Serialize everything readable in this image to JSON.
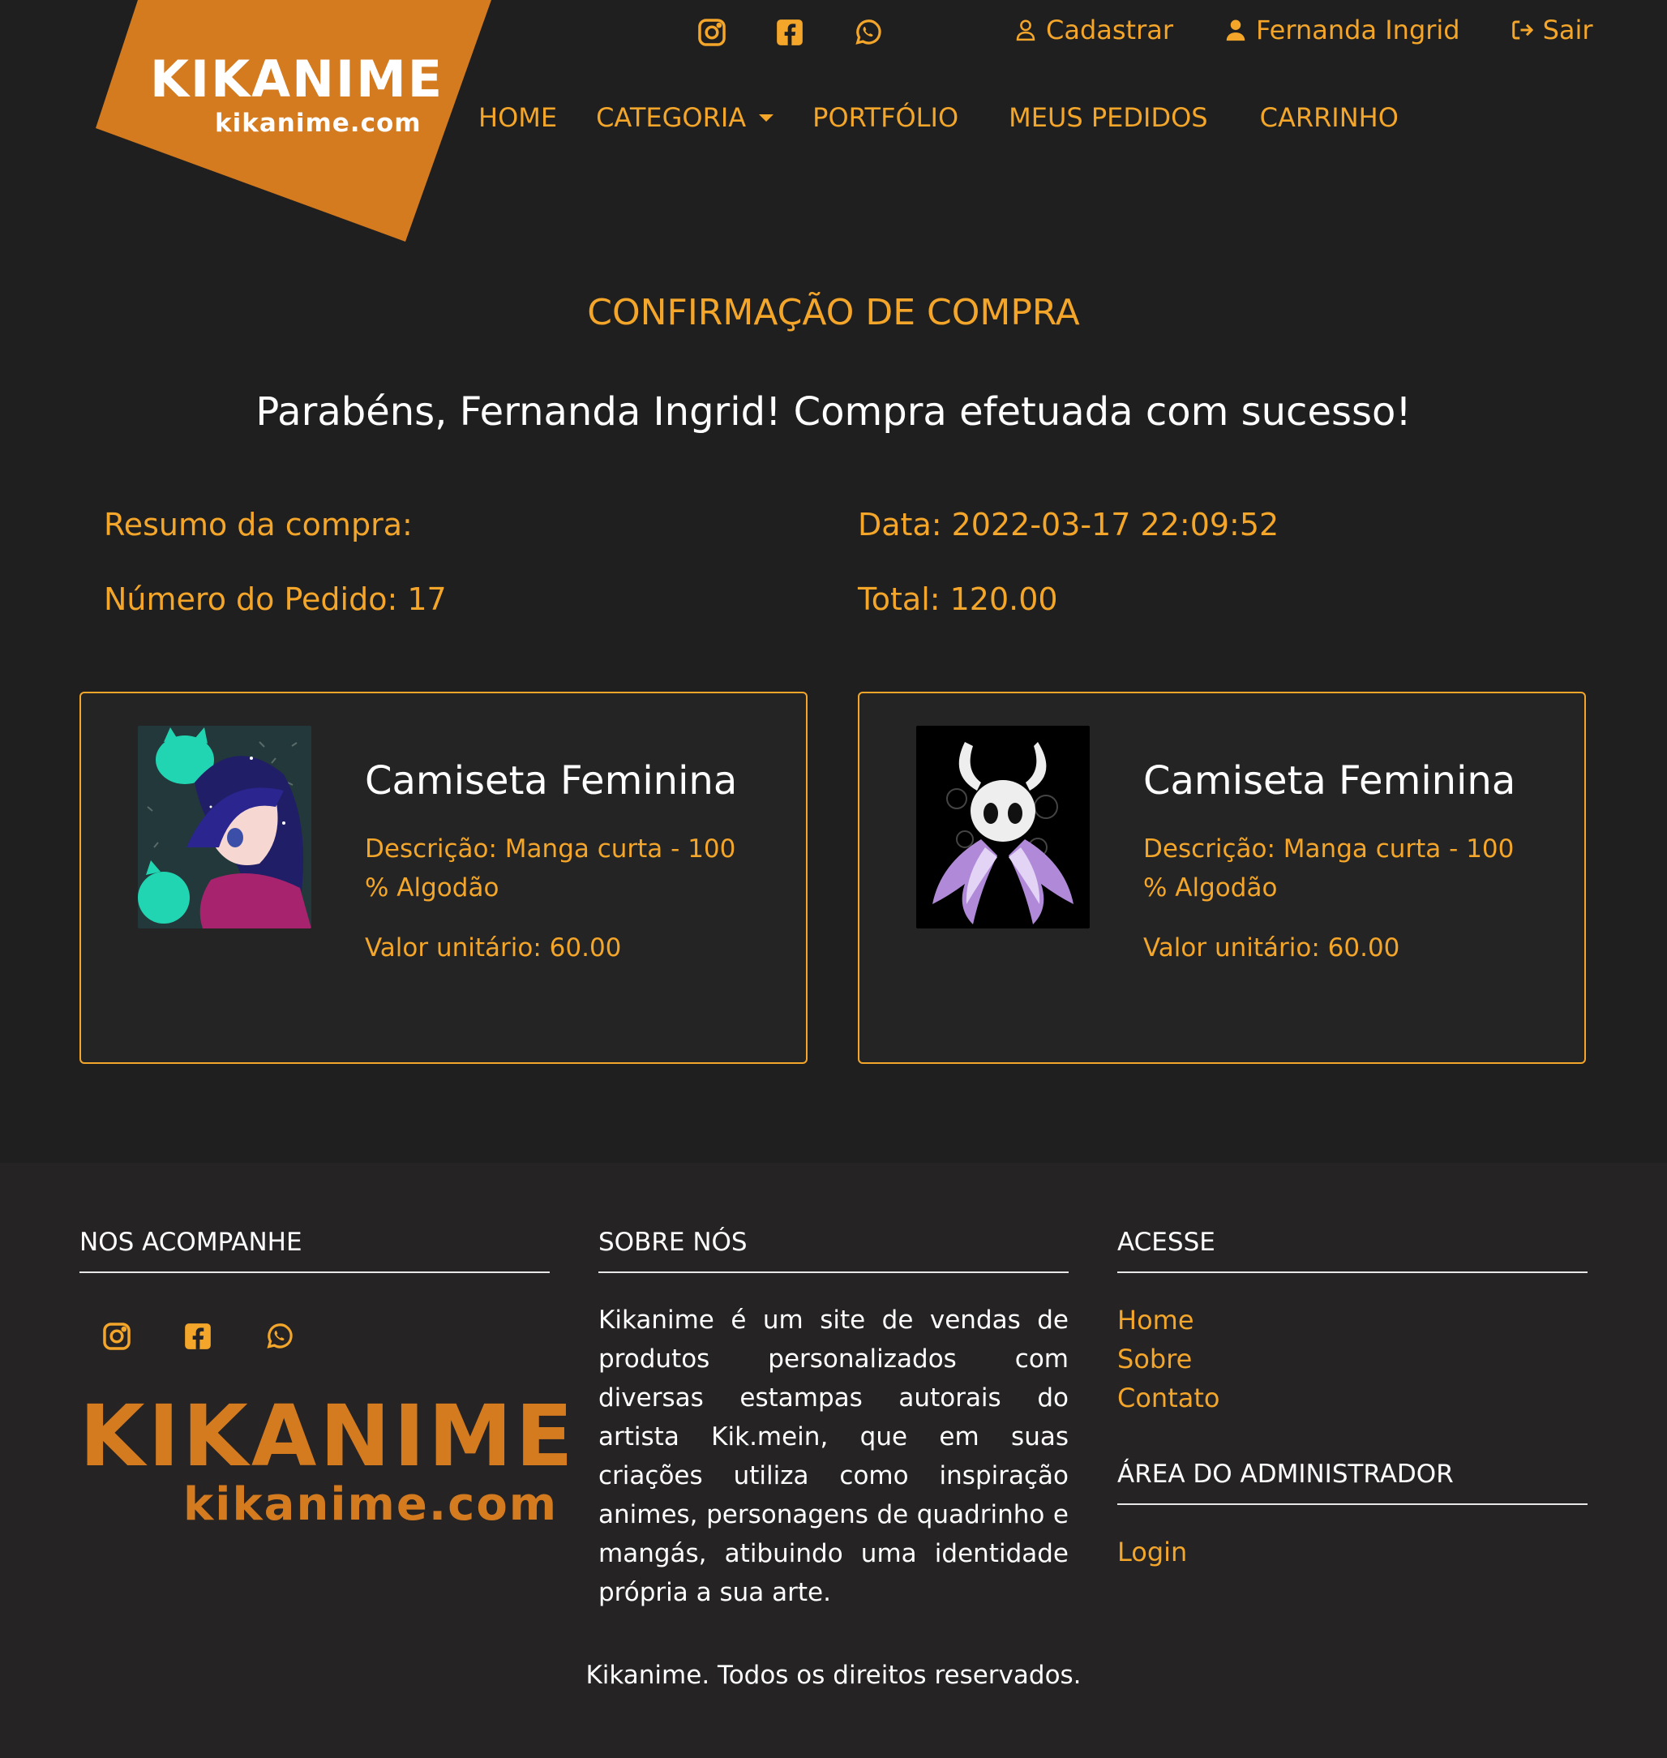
{
  "header": {
    "logo": {
      "name": "KIKANIME",
      "domain": "kikanime.com"
    },
    "social_icons": [
      "instagram-icon",
      "facebook-icon",
      "whatsapp-icon"
    ],
    "user_links": {
      "register": "Cadastrar",
      "user_name": "Fernanda Ingrid",
      "logout": "Sair"
    },
    "nav": [
      "HOME",
      "CATEGORIA",
      "PORTFÓLIO",
      "MEUS PEDIDOS",
      "CARRINHO"
    ]
  },
  "main": {
    "title": "CONFIRMAÇÃO DE COMPRA",
    "congrats": "Parabéns, Fernanda Ingrid! Compra efetuada com sucesso!",
    "summary": {
      "label": "Resumo da compra:",
      "date": "Data: 2022-03-17 22:09:52",
      "order_number": "Número do Pedido: 17",
      "total": "Total: 120.00"
    },
    "items": [
      {
        "title": "Camiseta Feminina",
        "description": "Descrição: Manga curta - 100 % Algodão",
        "price": "Valor unitário: 60.00"
      },
      {
        "title": "Camiseta Feminina",
        "description": "Descrição: Manga curta - 100 % Algodão",
        "price": "Valor unitário: 60.00"
      }
    ]
  },
  "footer": {
    "follow_heading": "NOS ACOMPANHE",
    "about_heading": "SOBRE NÓS",
    "about_text": "Kikanime é um site de vendas de produtos personalizados com diversas estampas autorais do artista Kik.mein, que em suas criações utiliza como inspiração animes, personagens de quadrinho e mangás, atibuindo uma identidade própria a sua arte.",
    "access_heading": "ACESSE",
    "access_links": [
      "Home",
      "Sobre",
      "Contato"
    ],
    "admin_heading": "ÁREA DO ADMINISTRADOR",
    "admin_link": "Login",
    "logo": {
      "name": "KIKANIME",
      "domain": "kikanime.com"
    },
    "copyright": "Kikanime. Todos os direitos reservados."
  },
  "colors": {
    "accent": "#f4a62a",
    "logo_orange": "#d47a1f",
    "background": "#1f1f1f",
    "footer_bg": "#252324"
  }
}
